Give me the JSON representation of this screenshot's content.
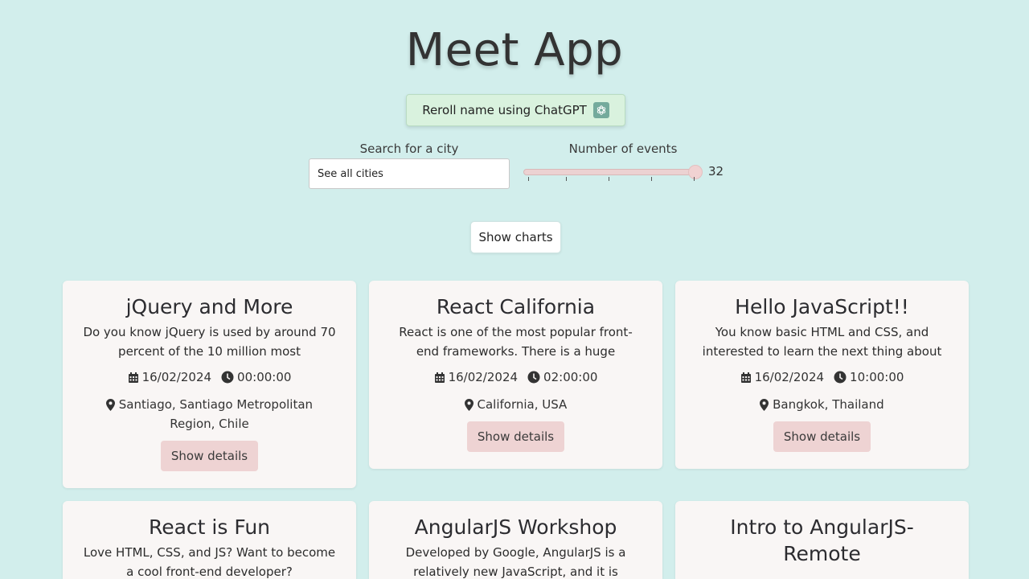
{
  "header": {
    "title": "Meet App",
    "reroll_label": "Reroll name using ChatGPT"
  },
  "filters": {
    "city_label": "Search for a city",
    "city_placeholder": "See all cities",
    "events_label": "Number of events",
    "events_value": "32",
    "slider_fraction": 1.0
  },
  "charts_button": "Show charts",
  "colors": {
    "background": "#d2eeec",
    "card": "#f9f6f5",
    "details_button": "#eed3d3",
    "reroll_button": "#d9f2de"
  },
  "events": [
    {
      "title": "jQuery and More",
      "description": "Do you know jQuery is used by around 70 percent of the 10 million most",
      "date": "16/02/2024",
      "time": "00:00:00",
      "location": "Santiago, Santiago Metropolitan Region, Chile",
      "button": "Show details"
    },
    {
      "title": "React California",
      "description": "React is one of the most popular front-end frameworks. There is a huge",
      "date": "16/02/2024",
      "time": "02:00:00",
      "location": "California, USA",
      "button": "Show details"
    },
    {
      "title": "Hello JavaScript!!",
      "description": "You know basic HTML and CSS, and interested to learn the next thing about",
      "date": "16/02/2024",
      "time": "10:00:00",
      "location": "Bangkok, Thailand",
      "button": "Show details"
    },
    {
      "title": "React is Fun",
      "description": "Love HTML, CSS, and JS? Want to become a cool front-end developer?",
      "date": "",
      "time": "",
      "location": "",
      "button": ""
    },
    {
      "title": "AngularJS Workshop",
      "description": "Developed by Google, AngularJS is a relatively new JavaScript, and it is",
      "date": "",
      "time": "",
      "location": "",
      "button": ""
    },
    {
      "title": "Intro to AngularJS-Remote",
      "description": "",
      "date": "",
      "time": "",
      "location": "",
      "button": ""
    }
  ]
}
